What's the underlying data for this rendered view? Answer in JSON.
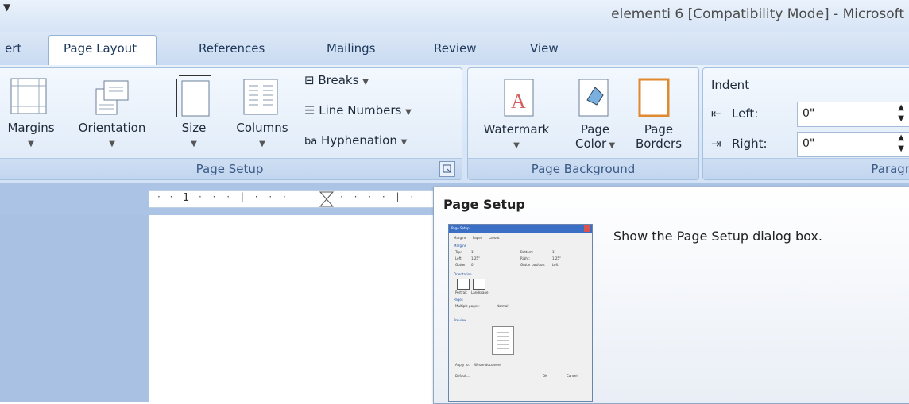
{
  "window": {
    "title": "elementi 6 [Compatibility Mode] - Microsoft"
  },
  "tabs": [
    {
      "label": "ert"
    },
    {
      "label": "Page Layout",
      "active": true
    },
    {
      "label": "References"
    },
    {
      "label": "Mailings"
    },
    {
      "label": "Review"
    },
    {
      "label": "View"
    }
  ],
  "page_setup": {
    "group_label": "Page Setup",
    "margins": "Margins",
    "orientation": "Orientation",
    "size": "Size",
    "columns": "Columns",
    "breaks": "Breaks",
    "line_numbers": "Line Numbers",
    "hyphenation": "Hyphenation"
  },
  "page_background": {
    "group_label": "Page Background",
    "watermark": "Watermark",
    "page_color_line1": "Page",
    "page_color_line2": "Color",
    "page_borders_line1": "Page",
    "page_borders_line2": "Borders"
  },
  "paragraph": {
    "group_label": "Paragr",
    "indent_label": "Indent",
    "left_label": "Left:",
    "left_value": "0\"",
    "right_label": "Right:",
    "right_value": "0\""
  },
  "ruler": {
    "marker": "1"
  },
  "tooltip": {
    "title": "Page Setup",
    "description": "Show the Page Setup dialog box.",
    "thumb": {
      "title": "Page Setup",
      "tabs": [
        "Margins",
        "Paper",
        "Layout"
      ],
      "margins_heading": "Margins",
      "top": "Top:",
      "bottom": "Bottom:",
      "left": "Left:",
      "right": "Right:",
      "gutter": "Gutter:",
      "gutter_position": "Gutter position:",
      "top_val": "1\"",
      "bottom_val": "1\"",
      "left_val": "1.25\"",
      "right_val": "1.25\"",
      "gutter_val": "0\"",
      "gutter_pos_val": "Left",
      "orientation_heading": "Orientation",
      "portrait": "Portrait",
      "landscape": "Landscape",
      "pages_heading": "Pages",
      "multiple_pages": "Multiple pages:",
      "multiple_pages_val": "Normal",
      "preview_heading": "Preview",
      "apply_to": "Apply to:",
      "apply_to_val": "Whole document",
      "default_btn": "Default...",
      "ok_btn": "OK",
      "cancel_btn": "Cancel"
    }
  }
}
